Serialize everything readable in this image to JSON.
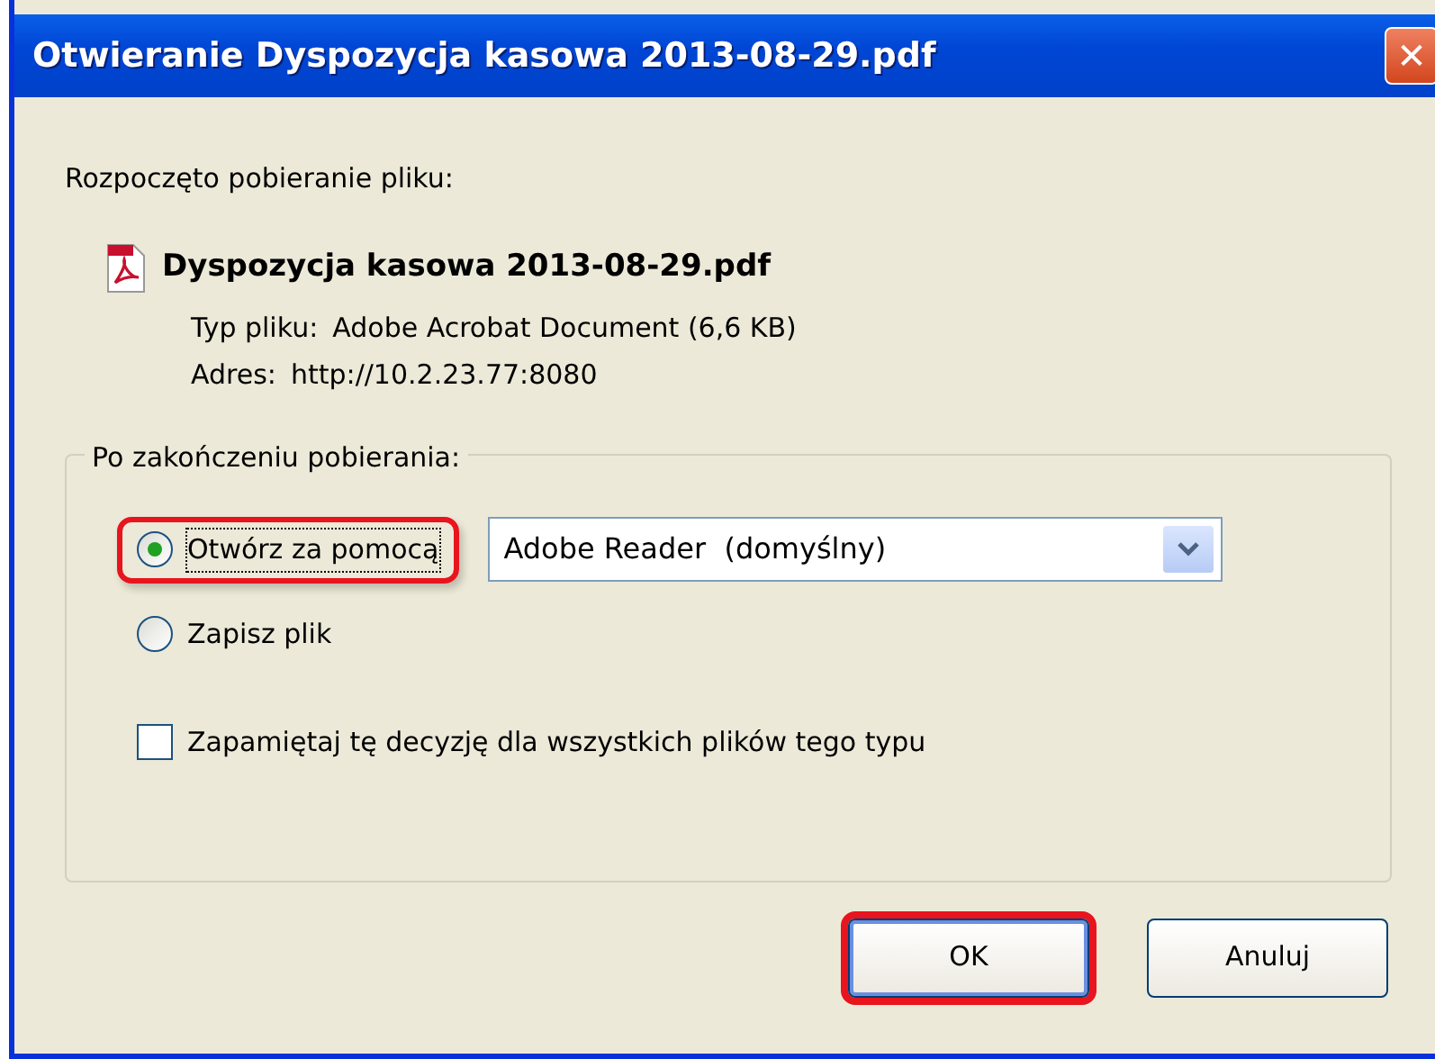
{
  "window": {
    "title": "Otwieranie Dyspozycja kasowa 2013-08-29.pdf",
    "close": "✕"
  },
  "intro": "Rozpoczęto pobieranie pliku:",
  "file": {
    "name": "Dyspozycja kasowa 2013-08-29.pdf",
    "type_label": "Typ pliku:",
    "type_value": "Adobe Acrobat Document (6,6 KB)",
    "address_label": "Adres:",
    "address_value": "http://10.2.23.77:8080"
  },
  "group": {
    "legend": "Po zakończeniu pobierania:",
    "options": [
      {
        "kind": "radio",
        "label": "Otwórz za pomocą",
        "selected": true,
        "highlighted": true
      },
      {
        "kind": "radio",
        "label": "Zapisz plik",
        "selected": false,
        "highlighted": false
      },
      {
        "kind": "checkbox",
        "label": "Zapamiętaj tę decyzję dla wszystkich plików tego typu",
        "checked": false,
        "highlighted": false
      }
    ],
    "app_select": {
      "value": "Adobe Reader  (domyślny)"
    }
  },
  "buttons": [
    {
      "label": "OK",
      "default": true,
      "highlighted": true
    },
    {
      "label": "Anuluj",
      "default": false,
      "highlighted": false
    }
  ]
}
